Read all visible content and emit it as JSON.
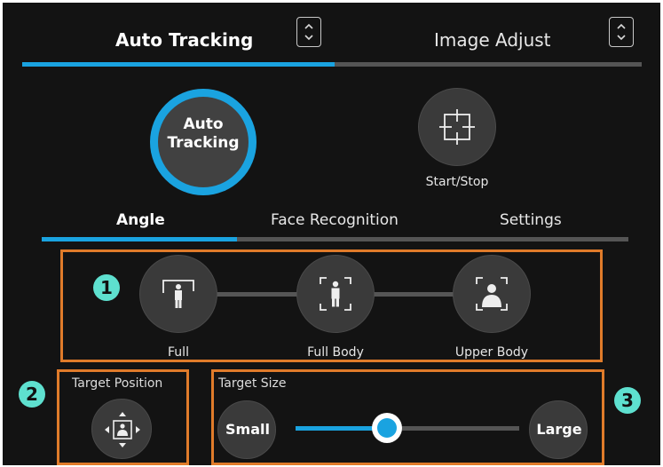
{
  "header_tabs": [
    {
      "label": "Auto Tracking",
      "active": true
    },
    {
      "label": "Image Adjust",
      "active": false
    }
  ],
  "controls": {
    "auto_tracking_button": "Auto\nTracking",
    "start_stop_label": "Start/Stop"
  },
  "sub_tabs": [
    {
      "label": "Angle",
      "active": true
    },
    {
      "label": "Face Recognition",
      "active": false
    },
    {
      "label": "Settings",
      "active": false
    }
  ],
  "angle_options": [
    {
      "label": "Full",
      "icon": "full-frame-icon"
    },
    {
      "label": "Full Body",
      "icon": "full-body-icon"
    },
    {
      "label": "Upper Body",
      "icon": "upper-body-icon"
    }
  ],
  "target_position": {
    "title": "Target Position",
    "icon": "target-position-icon"
  },
  "target_size": {
    "title": "Target Size",
    "small_label": "Small",
    "large_label": "Large",
    "value": 0.41
  },
  "badges": [
    "1",
    "2",
    "3"
  ],
  "colors": {
    "accent": "#1aa3e0",
    "highlight": "#e07b2a",
    "badge": "#5ee0cf"
  }
}
